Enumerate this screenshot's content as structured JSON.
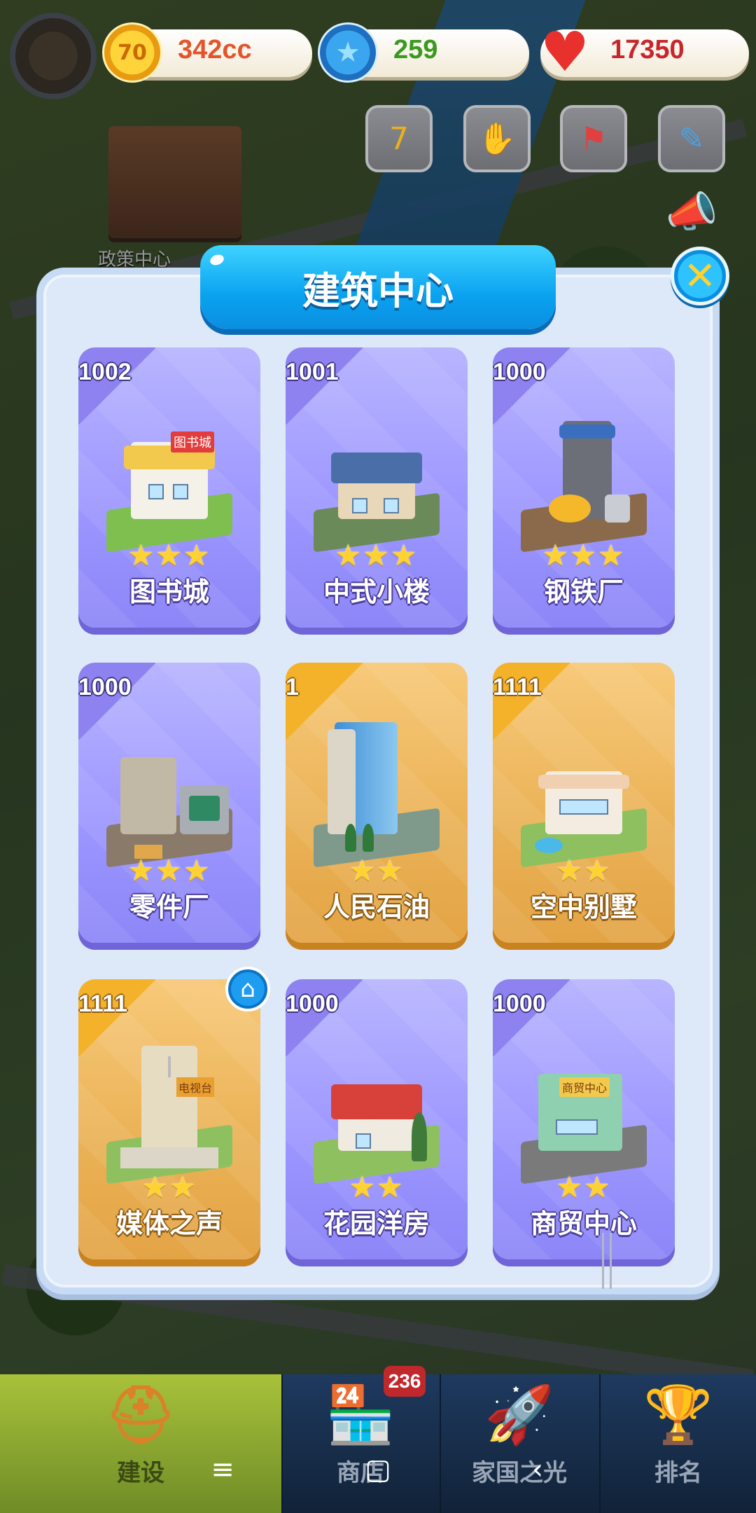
{
  "resources": {
    "coins": "342cc",
    "coin_icon_text": "70",
    "stars": "259",
    "hearts": "17350"
  },
  "background": {
    "label": "政策中心"
  },
  "panel": {
    "title": "建筑中心"
  },
  "cards": [
    {
      "num": "1002",
      "stars": "★★★",
      "name": "图书城",
      "theme": "purple"
    },
    {
      "num": "1001",
      "stars": "★★★",
      "name": "中式小楼",
      "theme": "purple"
    },
    {
      "num": "1000",
      "stars": "★★★",
      "name": "钢铁厂",
      "theme": "purple"
    },
    {
      "num": "1000",
      "stars": "★★★",
      "name": "零件厂",
      "theme": "purple"
    },
    {
      "num": "1",
      "stars": "★★",
      "name": "人民石油",
      "theme": "gold"
    },
    {
      "num": "1111",
      "stars": "★★",
      "name": "空中别墅",
      "theme": "gold"
    },
    {
      "num": "1111",
      "stars": "★★",
      "name": "媒体之声",
      "theme": "gold"
    },
    {
      "num": "1000",
      "stars": "★★",
      "name": "花园洋房",
      "theme": "purple"
    },
    {
      "num": "1000",
      "stars": "★★",
      "name": "商贸中心",
      "theme": "purple"
    }
  ],
  "building_signs": {
    "library": "图书城",
    "tv": "电视台",
    "trade": "商贸中心"
  },
  "bottom_nav": {
    "build": "建设",
    "shop": "商店",
    "homeland": "家国之光",
    "rank": "排名",
    "shop_badge": "236"
  },
  "colors": {
    "purple_card": "#9b95ff",
    "gold_card": "#eab155",
    "title_blue": "#0aa2f0",
    "star_yellow": "#ffd233"
  }
}
